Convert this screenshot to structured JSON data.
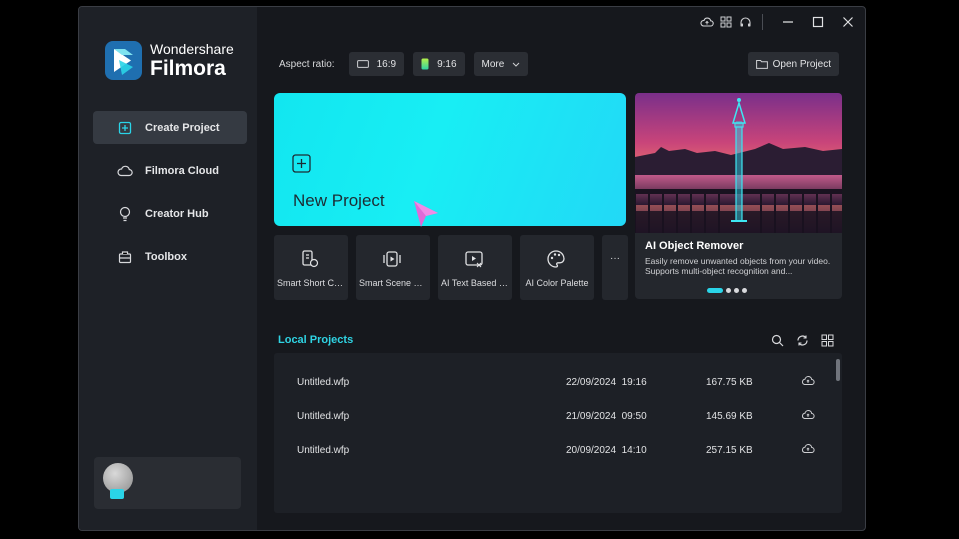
{
  "app": {
    "brand": "Wondershare",
    "product": "Filmora"
  },
  "sidebar": {
    "items": [
      {
        "label": "Create Project",
        "icon": "create-project-icon",
        "active": true
      },
      {
        "label": "Filmora Cloud",
        "icon": "cloud-icon",
        "active": false
      },
      {
        "label": "Creator Hub",
        "icon": "lightbulb-icon",
        "active": false
      },
      {
        "label": "Toolbox",
        "icon": "toolbox-icon",
        "active": false
      }
    ]
  },
  "titlebar": {
    "icons": [
      "cloud-upload-icon",
      "grid-icon",
      "headset-icon",
      "minimize-icon",
      "maximize-icon",
      "close-icon"
    ]
  },
  "toolbar": {
    "aspect_label": "Aspect ratio:",
    "ratio_169": "16:9",
    "ratio_916": "9:16",
    "more_label": "More",
    "open_project": "Open Project"
  },
  "new_project": {
    "label": "New Project"
  },
  "tools": [
    {
      "label": "Smart Short Cli...",
      "icon": "smart-short-clips-icon"
    },
    {
      "label": "Smart Scene Cut",
      "icon": "smart-scene-cut-icon"
    },
    {
      "label": "AI Text Based Edi...",
      "icon": "ai-text-edit-icon"
    },
    {
      "label": "AI Color Palette",
      "icon": "ai-color-palette-icon"
    },
    {
      "label": "···",
      "icon": "more-icon"
    }
  ],
  "promo": {
    "title": "AI Object Remover",
    "description": "Easily remove unwanted objects from your video. Supports multi-object recognition and...",
    "slides": 4,
    "active_slide": 0
  },
  "local_projects": {
    "title": "Local Projects",
    "rows": [
      {
        "name": "Untitled.wfp",
        "date": "22/09/2024  19:16",
        "size": "167.75 KB"
      },
      {
        "name": "Untitled.wfp",
        "date": "21/09/2024  09:50",
        "size": "145.69 KB"
      },
      {
        "name": "Untitled.wfp",
        "date": "20/09/2024  14:10",
        "size": "257.15 KB"
      }
    ]
  },
  "colors": {
    "accent": "#2ad4e8",
    "new_project_bg": "#18eef4",
    "window_bg": "#16181d",
    "sidebar_bg": "#1e2127"
  }
}
